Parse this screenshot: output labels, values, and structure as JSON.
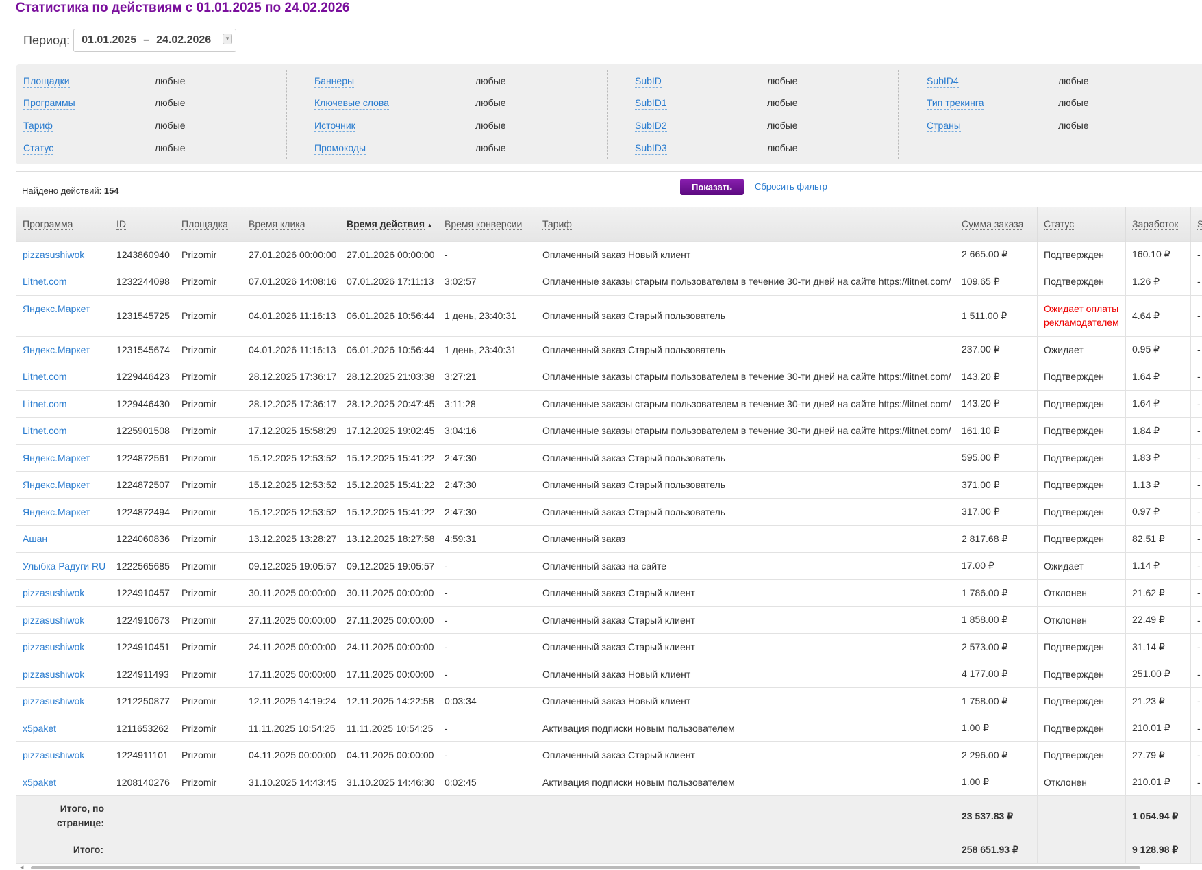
{
  "title": "Статистика по действиям с 01.01.2025 по 24.02.2026",
  "period": {
    "label": "Период:",
    "from": "01.01.2025",
    "dash": "–",
    "to": "24.02.2026"
  },
  "filters": [
    [
      {
        "label": "Площадки",
        "value": "любые"
      },
      {
        "label": "Программы",
        "value": "любые"
      },
      {
        "label": "Тариф",
        "value": "любые"
      },
      {
        "label": "Статус",
        "value": "любые"
      }
    ],
    [
      {
        "label": "Баннеры",
        "value": "любые"
      },
      {
        "label": "Ключевые слова",
        "value": "любые"
      },
      {
        "label": "Источник",
        "value": "любые"
      },
      {
        "label": "Промокоды",
        "value": "любые"
      }
    ],
    [
      {
        "label": "SubID",
        "value": "любые"
      },
      {
        "label": "SubID1",
        "value": "любые"
      },
      {
        "label": "SubID2",
        "value": "любые"
      },
      {
        "label": "SubID3",
        "value": "любые"
      }
    ],
    [
      {
        "label": "SubID4",
        "value": "любые"
      },
      {
        "label": "Тип трекинга",
        "value": "любые"
      },
      {
        "label": "Страны",
        "value": "любые"
      }
    ]
  ],
  "found": {
    "label": "Найдено действий:",
    "count": "154"
  },
  "show_button": "Показать",
  "reset_link": "Сбросить фильтр",
  "columns": [
    "Программа",
    "ID",
    "Площадка",
    "Время клика",
    "Время действия",
    "Время конверсии",
    "Тариф",
    "Сумма заказа",
    "Статус",
    "Заработок",
    "S"
  ],
  "sorted_column": "Время действия",
  "sort_indicator": "▲",
  "colors": {
    "accent": "#7a0f9c",
    "link": "#2a7ccf",
    "status_red": "#ee0000"
  },
  "rows": [
    [
      "pizzasushiwok",
      "1243860940",
      "Prizomir",
      "27.01.2026 00:00:00",
      "27.01.2026 00:00:00",
      "-",
      "Оплаченный заказ Новый клиент",
      "2 665.00 ₽",
      "Подтвержден",
      "160.10 ₽",
      "-"
    ],
    [
      "Litnet.com",
      "1232244098",
      "Prizomir",
      "07.01.2026 14:08:16",
      "07.01.2026 17:11:13",
      "3:02:57",
      "Оплаченные заказы старым пользователем в течение 30-ти дней на сайте https://litnet.com/",
      "109.65 ₽",
      "Подтвержден",
      "1.26 ₽",
      "-"
    ],
    [
      "Яндекс.Маркет",
      "1231545725",
      "Prizomir",
      "04.01.2026 11:16:13",
      "06.01.2026 10:56:44",
      "1 день, 23:40:31",
      "Оплаченный заказ Старый пользователь",
      "1 511.00 ₽",
      "Ожидает оплаты рекламодателем",
      "4.64 ₽",
      "-"
    ],
    [
      "Яндекс.Маркет",
      "1231545674",
      "Prizomir",
      "04.01.2026 11:16:13",
      "06.01.2026 10:56:44",
      "1 день, 23:40:31",
      "Оплаченный заказ Старый пользователь",
      "237.00 ₽",
      "Ожидает",
      "0.95 ₽",
      "-"
    ],
    [
      "Litnet.com",
      "1229446423",
      "Prizomir",
      "28.12.2025 17:36:17",
      "28.12.2025 21:03:38",
      "3:27:21",
      "Оплаченные заказы старым пользователем в течение 30-ти дней на сайте https://litnet.com/",
      "143.20 ₽",
      "Подтвержден",
      "1.64 ₽",
      "-"
    ],
    [
      "Litnet.com",
      "1229446430",
      "Prizomir",
      "28.12.2025 17:36:17",
      "28.12.2025 20:47:45",
      "3:11:28",
      "Оплаченные заказы старым пользователем в течение 30-ти дней на сайте https://litnet.com/",
      "143.20 ₽",
      "Подтвержден",
      "1.64 ₽",
      "-"
    ],
    [
      "Litnet.com",
      "1225901508",
      "Prizomir",
      "17.12.2025 15:58:29",
      "17.12.2025 19:02:45",
      "3:04:16",
      "Оплаченные заказы старым пользователем в течение 30-ти дней на сайте https://litnet.com/",
      "161.10 ₽",
      "Подтвержден",
      "1.84 ₽",
      "-"
    ],
    [
      "Яндекс.Маркет",
      "1224872561",
      "Prizomir",
      "15.12.2025 12:53:52",
      "15.12.2025 15:41:22",
      "2:47:30",
      "Оплаченный заказ Старый пользователь",
      "595.00 ₽",
      "Подтвержден",
      "1.83 ₽",
      "-"
    ],
    [
      "Яндекс.Маркет",
      "1224872507",
      "Prizomir",
      "15.12.2025 12:53:52",
      "15.12.2025 15:41:22",
      "2:47:30",
      "Оплаченный заказ Старый пользователь",
      "371.00 ₽",
      "Подтвержден",
      "1.13 ₽",
      "-"
    ],
    [
      "Яндекс.Маркет",
      "1224872494",
      "Prizomir",
      "15.12.2025 12:53:52",
      "15.12.2025 15:41:22",
      "2:47:30",
      "Оплаченный заказ Старый пользователь",
      "317.00 ₽",
      "Подтвержден",
      "0.97 ₽",
      "-"
    ],
    [
      "Ашан",
      "1224060836",
      "Prizomir",
      "13.12.2025 13:28:27",
      "13.12.2025 18:27:58",
      "4:59:31",
      "Оплаченный заказ",
      "2 817.68 ₽",
      "Подтвержден",
      "82.51 ₽",
      "-"
    ],
    [
      "Улыбка Радуги RU",
      "1222565685",
      "Prizomir",
      "09.12.2025 19:05:57",
      "09.12.2025 19:05:57",
      "-",
      "Оплаченный заказ на сайте",
      "17.00 ₽",
      "Ожидает",
      "1.14 ₽",
      "-"
    ],
    [
      "pizzasushiwok",
      "1224910457",
      "Prizomir",
      "30.11.2025 00:00:00",
      "30.11.2025 00:00:00",
      "-",
      "Оплаченный заказ Старый клиент",
      "1 786.00 ₽",
      "Отклонен",
      "21.62 ₽",
      "-"
    ],
    [
      "pizzasushiwok",
      "1224910673",
      "Prizomir",
      "27.11.2025 00:00:00",
      "27.11.2025 00:00:00",
      "-",
      "Оплаченный заказ Старый клиент",
      "1 858.00 ₽",
      "Отклонен",
      "22.49 ₽",
      "-"
    ],
    [
      "pizzasushiwok",
      "1224910451",
      "Prizomir",
      "24.11.2025 00:00:00",
      "24.11.2025 00:00:00",
      "-",
      "Оплаченный заказ Старый клиент",
      "2 573.00 ₽",
      "Подтвержден",
      "31.14 ₽",
      "-"
    ],
    [
      "pizzasushiwok",
      "1224911493",
      "Prizomir",
      "17.11.2025 00:00:00",
      "17.11.2025 00:00:00",
      "-",
      "Оплаченный заказ Новый клиент",
      "4 177.00 ₽",
      "Подтвержден",
      "251.00 ₽",
      "-"
    ],
    [
      "pizzasushiwok",
      "1212250877",
      "Prizomir",
      "12.11.2025 14:19:24",
      "12.11.2025 14:22:58",
      "0:03:34",
      "Оплаченный заказ Новый клиент",
      "1 758.00 ₽",
      "Подтвержден",
      "21.23 ₽",
      "-"
    ],
    [
      "x5paket",
      "1211653262",
      "Prizomir",
      "11.11.2025 10:54:25",
      "11.11.2025 10:54:25",
      "-",
      "Активация подписки новым пользователем",
      "1.00 ₽",
      "Подтвержден",
      "210.01 ₽",
      "-"
    ],
    [
      "pizzasushiwok",
      "1224911101",
      "Prizomir",
      "04.11.2025 00:00:00",
      "04.11.2025 00:00:00",
      "-",
      "Оплаченный заказ Старый клиент",
      "2 296.00 ₽",
      "Подтвержден",
      "27.79 ₽",
      "-"
    ],
    [
      "x5paket",
      "1208140276",
      "Prizomir",
      "31.10.2025 14:43:45",
      "31.10.2025 14:46:30",
      "0:02:45",
      "Активация подписки новым пользователем",
      "1.00 ₽",
      "Отклонен",
      "210.01 ₽",
      "-"
    ]
  ],
  "totals": [
    {
      "label": "Итого, по странице:",
      "sum": "23 537.83 ₽",
      "earn": "1 054.94 ₽"
    },
    {
      "label": "Итого:",
      "sum": "258 651.93 ₽",
      "earn": "9 128.98 ₽"
    }
  ]
}
